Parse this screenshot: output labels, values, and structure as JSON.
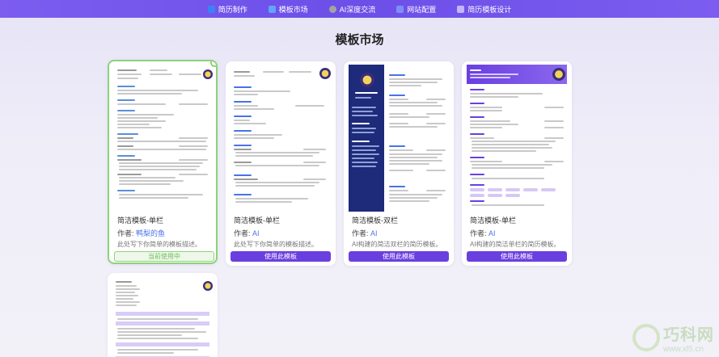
{
  "nav": {
    "items": [
      {
        "label": "简历制作",
        "icon": "edit-icon",
        "color": "#3b82f6"
      },
      {
        "label": "模板市场",
        "icon": "template-icon",
        "color": "#60a5fa"
      },
      {
        "label": "AI深度交流",
        "icon": "robot-icon",
        "color": "#a3a3a3"
      },
      {
        "label": "网站配置",
        "icon": "settings-icon",
        "color": "#818cf8"
      },
      {
        "label": "简历模板设计",
        "icon": "design-icon",
        "color": "#7c5df0"
      }
    ]
  },
  "page": {
    "title": "模板市场"
  },
  "cards": [
    {
      "title": "简洁模板-单栏",
      "author_label": "作者:",
      "author": "鸭梨的鱼",
      "desc": "此处写下你简单的模板描述。",
      "button": "当前使用中",
      "state": "current"
    },
    {
      "title": "简洁模板-单栏",
      "author_label": "作者:",
      "author": "AI",
      "desc": "此处写下你简单的模板描述。",
      "button": "使用此模板",
      "state": "available"
    },
    {
      "title": "简洁模板-双栏",
      "author_label": "作者:",
      "author": "AI",
      "desc": "AI构建的简洁双栏的简历模板。",
      "button": "使用此模板",
      "state": "available"
    },
    {
      "title": "简洁模板-单栏",
      "author_label": "作者:",
      "author": "AI",
      "desc": "AI构建的简洁单栏的简历模板。",
      "button": "使用此模板",
      "state": "available"
    }
  ],
  "watermark": {
    "brand": "巧科网",
    "url": "www.xl5.cn"
  },
  "colors": {
    "accent": "#6a3fe0",
    "nav": "#7c5df0",
    "selected": "#8ed27a"
  }
}
